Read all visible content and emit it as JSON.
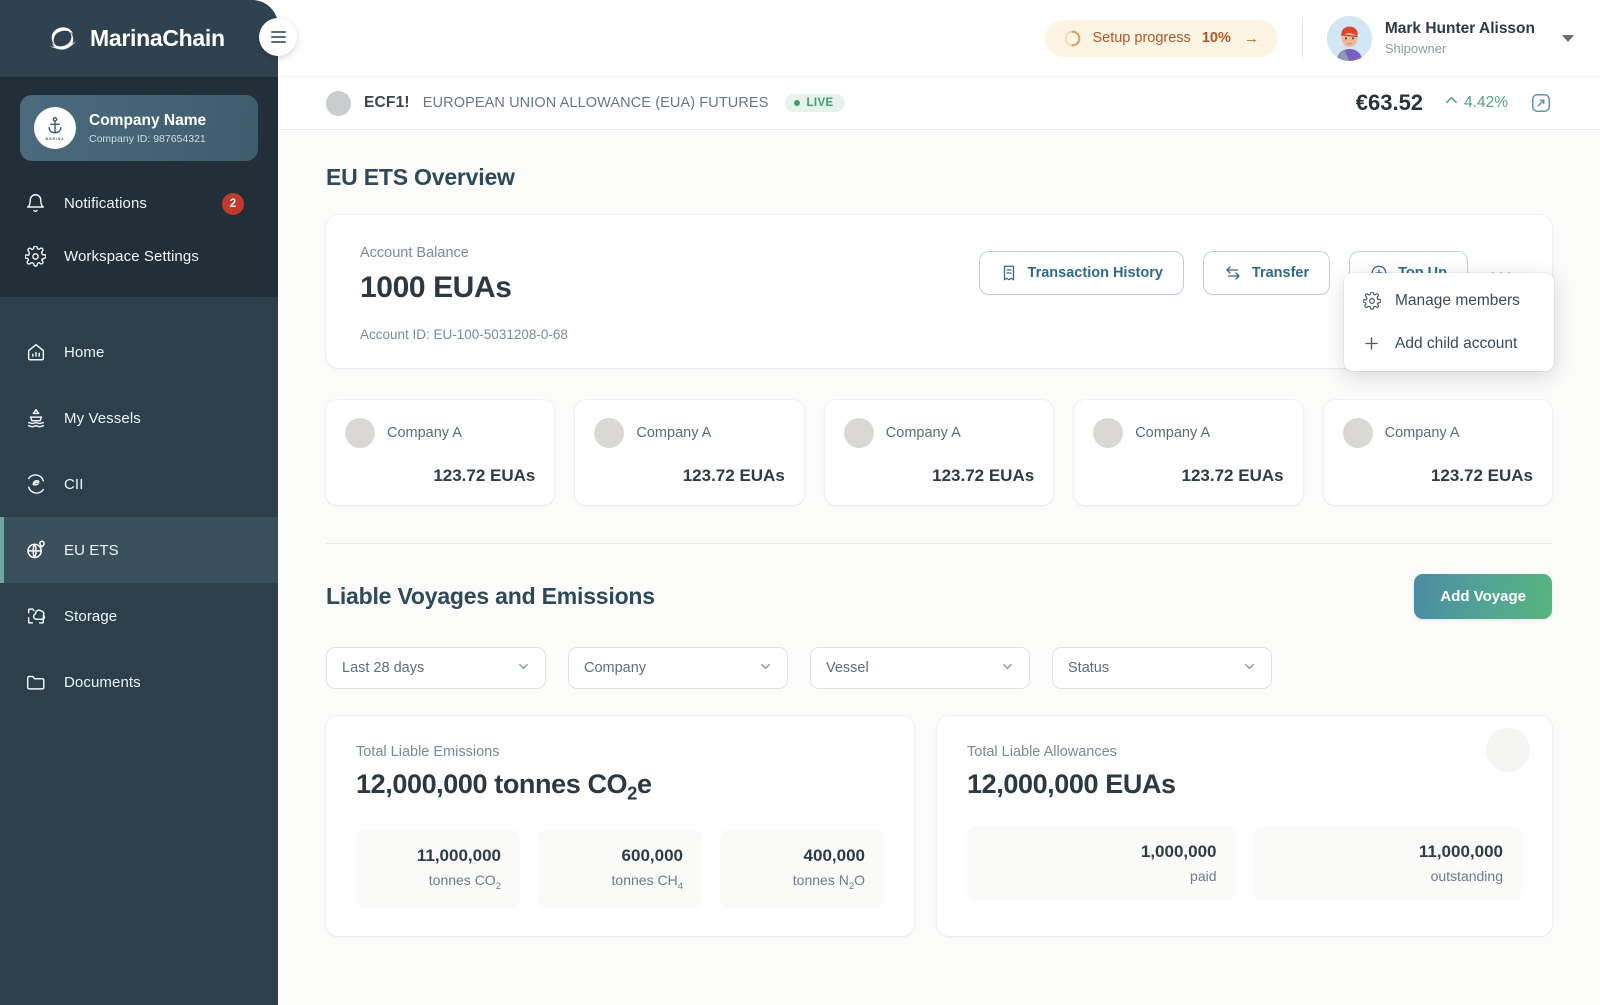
{
  "brand": {
    "name": "MarinaChain",
    "logo_icon": "wave-logo-icon",
    "menu_icon": "hamburger-icon"
  },
  "sidebar": {
    "company": {
      "name": "Company Name",
      "id_label": "Company ID: 987654321",
      "avatar_icon": "anchor-icon",
      "avatar_mini_text": "MARINA"
    },
    "utility_items": [
      {
        "label": "Notifications",
        "icon": "bell-icon",
        "badge": "2"
      },
      {
        "label": "Workspace Settings",
        "icon": "gear-icon",
        "badge": ""
      }
    ],
    "nav_items": [
      {
        "label": "Home",
        "icon": "home-chart-icon",
        "active": false
      },
      {
        "label": "My Vessels",
        "icon": "ship-icon",
        "active": false
      },
      {
        "label": "CII",
        "icon": "leaf-cycle-icon",
        "active": false
      },
      {
        "label": "EU ETS",
        "icon": "globe-pin-icon",
        "active": true
      },
      {
        "label": "Storage",
        "icon": "cloud-storage-icon",
        "active": false
      },
      {
        "label": "Documents",
        "icon": "folder-icon",
        "active": false
      }
    ],
    "active_accent": "#6fa8a0"
  },
  "topbar": {
    "setup_progress_label": "Setup progress",
    "setup_progress_percent": "10%",
    "setup_arrow_icon": "arrow-right-icon",
    "setup_ring_icon": "progress-ring-icon",
    "setup_color": "#b1562a",
    "user": {
      "name": "Mark Hunter Alisson",
      "role": "Shipowner",
      "avatar_icon": "user-avatar",
      "caret_icon": "chevron-down-icon"
    }
  },
  "ticker": {
    "dot_icon": "instrument-dot-icon",
    "symbol": "ECF1!",
    "description": "EUROPEAN UNION ALLOWANCE (EUA) FUTURES",
    "status_label": "LIVE",
    "status_color": "#3f9c6d",
    "price": "€63.52",
    "change": "4.42%",
    "change_direction_icon": "caret-up-icon",
    "change_color": "#56a383",
    "expand_icon": "expand-panel-icon"
  },
  "overview": {
    "title": "EU ETS Overview",
    "balance": {
      "label": "Account Balance",
      "value": "1000 EUAs",
      "account_id": "Account ID: EU-100-5031208-0-68"
    },
    "actions": [
      {
        "label": "Transaction History",
        "icon": "receipt-icon"
      },
      {
        "label": "Transfer",
        "icon": "transfer-arrows-icon"
      },
      {
        "label": "Top Up",
        "icon": "plus-circle-icon"
      }
    ],
    "more_icon": "ellipsis-icon",
    "dropdown": [
      {
        "label": "Manage members",
        "icon": "gear-icon"
      },
      {
        "label": "Add child account",
        "icon": "plus-icon"
      }
    ],
    "company_cards": [
      {
        "name": "Company A",
        "value": "123.72 EUAs",
        "avatar_icon": "company-avatar-icon"
      },
      {
        "name": "Company A",
        "value": "123.72 EUAs",
        "avatar_icon": "company-avatar-icon"
      },
      {
        "name": "Company A",
        "value": "123.72 EUAs",
        "avatar_icon": "company-avatar-icon"
      },
      {
        "name": "Company A",
        "value": "123.72 EUAs",
        "avatar_icon": "company-avatar-icon"
      },
      {
        "name": "Company A",
        "value": "123.72 EUAs",
        "avatar_icon": "company-avatar-icon"
      }
    ]
  },
  "voyages": {
    "title": "Liable Voyages and Emissions",
    "add_button_label": "Add Voyage",
    "filters": [
      {
        "value": "Last 28 days",
        "name": "date-range"
      },
      {
        "value": "Company",
        "name": "company"
      },
      {
        "value": "Vessel",
        "name": "vessel"
      },
      {
        "value": "Status",
        "name": "status"
      }
    ],
    "emissions": {
      "label": "Total Liable Emissions",
      "value_number": "12,000,000",
      "value_unit_prefix": "tonnes CO",
      "value_unit_sub": "2",
      "value_unit_suffix": "e",
      "breakdown": [
        {
          "value": "11,000,000",
          "unit_prefix": "tonnes CO",
          "unit_sub": "2",
          "unit_suffix": ""
        },
        {
          "value": "600,000",
          "unit_prefix": "tonnes CH",
          "unit_sub": "4",
          "unit_suffix": ""
        },
        {
          "value": "400,000",
          "unit_prefix": "tonnes N",
          "unit_sub": "2",
          "unit_suffix": "O"
        }
      ]
    },
    "allowances": {
      "label": "Total Liable Allowances",
      "value": "12,000,000 EUAs",
      "breakdown": [
        {
          "value": "1,000,000",
          "label": "paid"
        },
        {
          "value": "11,000,000",
          "label": "outstanding"
        }
      ]
    }
  }
}
